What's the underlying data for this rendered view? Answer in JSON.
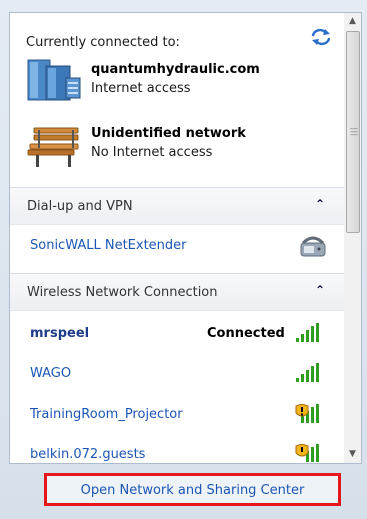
{
  "header": {
    "title": "Currently connected to:"
  },
  "connections": [
    {
      "name": "quantumhydraulic.com",
      "status": "Internet access",
      "icon": "domain-network-icon"
    },
    {
      "name": "Unidentified network",
      "status": "No Internet access",
      "icon": "public-bench-network-icon"
    }
  ],
  "sections": {
    "dialup": {
      "label": "Dial-up and VPN",
      "items": [
        {
          "name": "SonicWALL NetExtender",
          "icon": "phone-modem-icon"
        }
      ]
    },
    "wireless": {
      "label": "Wireless Network Connection",
      "networks": [
        {
          "name": "mrspeel",
          "status": "Connected",
          "secure": true
        },
        {
          "name": "WAGO",
          "status": "",
          "secure": true
        },
        {
          "name": "TrainingRoom_Projector",
          "status": "",
          "secure": false
        },
        {
          "name": "belkin.072.guests",
          "status": "",
          "secure": false
        }
      ]
    }
  },
  "footer": {
    "link": "Open Network and Sharing Center"
  },
  "colors": {
    "link": "#1c56b5",
    "highlight_border": "#e6151b",
    "signal": "#2f9d1f"
  }
}
